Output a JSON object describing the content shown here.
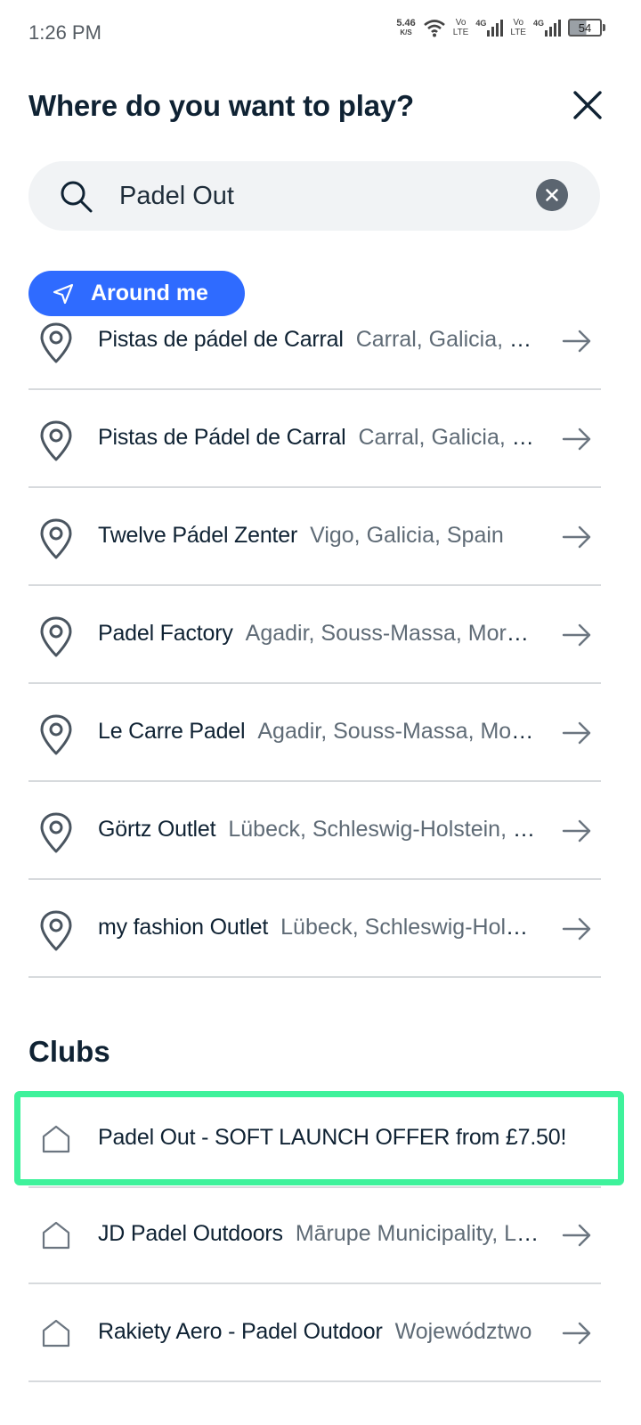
{
  "status_bar": {
    "time": "1:26 PM",
    "net_speed_value": "5.46",
    "net_speed_unit": "K/S",
    "sim1_volte_top": "Vo",
    "sim1_volte_bottom": "LTE",
    "sim1_network": "4G",
    "sim2_volte_top": "Vo",
    "sim2_volte_bottom": "LTE",
    "sim2_network": "4G",
    "battery_level": "54"
  },
  "header": {
    "title": "Where do you want to play?",
    "close_icon": "close-icon"
  },
  "search": {
    "value": "Padel Out",
    "icon": "search-icon",
    "clear_icon": "clear-icon"
  },
  "around_me": {
    "label": "Around me",
    "icon": "navigation-arrow-icon"
  },
  "places": [
    {
      "name": "Pistas de pádel de Carral",
      "location": "Carral, Galicia, Spain"
    },
    {
      "name": "Pistas de Pádel de Carral",
      "location": "Carral, Galicia, Spain"
    },
    {
      "name": "Twelve Pádel Zenter",
      "location": "Vigo, Galicia, Spain"
    },
    {
      "name": "Padel Factory",
      "location": "Agadir, Souss-Massa, Morocco"
    },
    {
      "name": "Le Carre Padel",
      "location": "Agadir, Souss-Massa, Morocco"
    },
    {
      "name": "Görtz Outlet",
      "location": "Lübeck, Schleswig-Holstein, Germany"
    },
    {
      "name": "my fashion Outlet",
      "location": "Lübeck, Schleswig-Holstein, Germany"
    }
  ],
  "clubs_section": {
    "title": "Clubs",
    "items": [
      {
        "name": "Padel Out - SOFT LAUNCH OFFER from £7.50!",
        "location": ""
      },
      {
        "name": "JD Padel Outdoors",
        "location": "Mārupe Municipality, Latvia"
      },
      {
        "name": "Rakiety Aero - Padel Outdoor",
        "location": "Województwo"
      }
    ]
  },
  "colors": {
    "accent_blue": "#2f6bff",
    "highlight_green": "#3ef29b",
    "title_text": "#0f2233",
    "secondary_text": "#5f6b76",
    "divider": "#d7dadd",
    "search_bg": "#f1f3f5"
  }
}
